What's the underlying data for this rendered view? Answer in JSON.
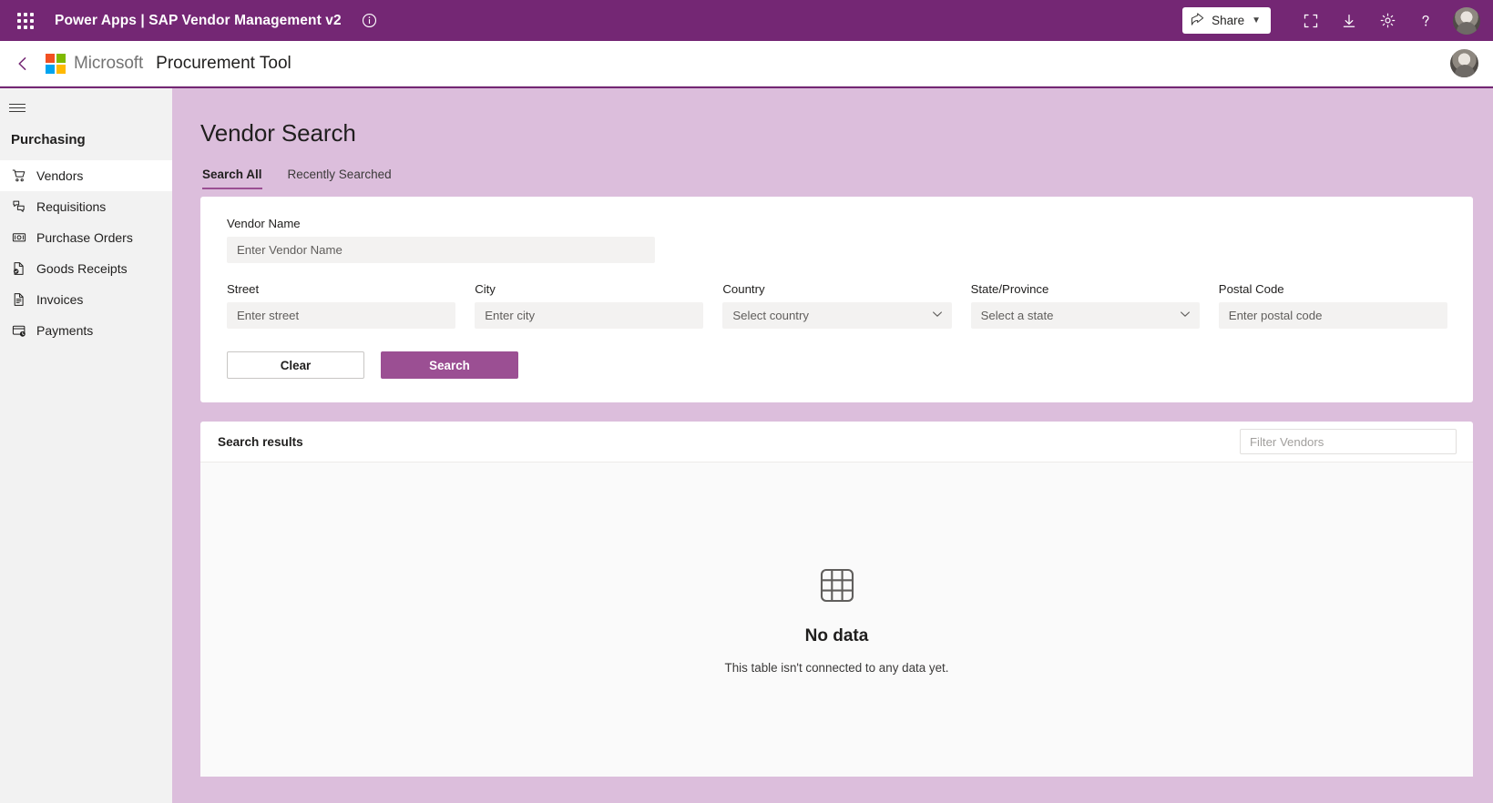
{
  "topbar": {
    "waffle_icon": "app-launcher-icon",
    "product": "Power Apps",
    "separator": "|",
    "app_name": "SAP Vendor Management v2",
    "title": "Power Apps  |  SAP Vendor Management v2",
    "info_icon": "info-icon",
    "share_label": "Share",
    "share_icon": "share-icon",
    "share_chevron": "chevron-down-icon",
    "fullscreen_icon": "fullscreen-icon",
    "download_icon": "download-icon",
    "settings_icon": "gear-icon",
    "help_icon": "help-icon",
    "avatar": "user-avatar",
    "background_color": "#742774"
  },
  "appheader": {
    "back_icon": "chevron-left-icon",
    "brand": "Microsoft",
    "app_title": "Procurement Tool",
    "logo_colors": [
      "#F25022",
      "#7FBA00",
      "#00A4EF",
      "#FFB900"
    ]
  },
  "sidebar": {
    "menu_icon": "hamburger-menu-icon",
    "section_title": "Purchasing",
    "items": [
      {
        "label": "Vendors",
        "icon": "shopping-cart-icon",
        "active": true
      },
      {
        "label": "Requisitions",
        "icon": "requisitions-icon",
        "active": false
      },
      {
        "label": "Purchase Orders",
        "icon": "money-icon",
        "active": false
      },
      {
        "label": "Goods Receipts",
        "icon": "document-check-icon",
        "active": false
      },
      {
        "label": "Invoices",
        "icon": "invoice-document-icon",
        "active": false
      },
      {
        "label": "Payments",
        "icon": "payment-card-clock-icon",
        "active": false
      }
    ]
  },
  "main": {
    "page_title": "Vendor Search",
    "background_color": "#dcbedc",
    "accent_color": "#9b4f93",
    "tabs": [
      {
        "label": "Search All",
        "active": true
      },
      {
        "label": "Recently Searched",
        "active": false
      }
    ],
    "search_form": {
      "vendor_name": {
        "label": "Vendor Name",
        "placeholder": "Enter Vendor Name",
        "value": ""
      },
      "street": {
        "label": "Street",
        "placeholder": "Enter street",
        "value": ""
      },
      "city": {
        "label": "City",
        "placeholder": "Enter city",
        "value": ""
      },
      "country": {
        "label": "Country",
        "placeholder": "Select country",
        "value": "",
        "type": "select"
      },
      "state": {
        "label": "State/Province",
        "placeholder": "Select a state",
        "value": "",
        "type": "select"
      },
      "postal_code": {
        "label": "Postal Code",
        "placeholder": "Enter postal code",
        "value": ""
      },
      "clear_label": "Clear",
      "search_label": "Search"
    },
    "results": {
      "title": "Search results",
      "filter_placeholder": "Filter Vendors",
      "filter_value": "",
      "empty_icon": "table-grid-icon",
      "empty_title": "No data",
      "empty_subtitle": "This table isn't connected to any data yet."
    }
  }
}
